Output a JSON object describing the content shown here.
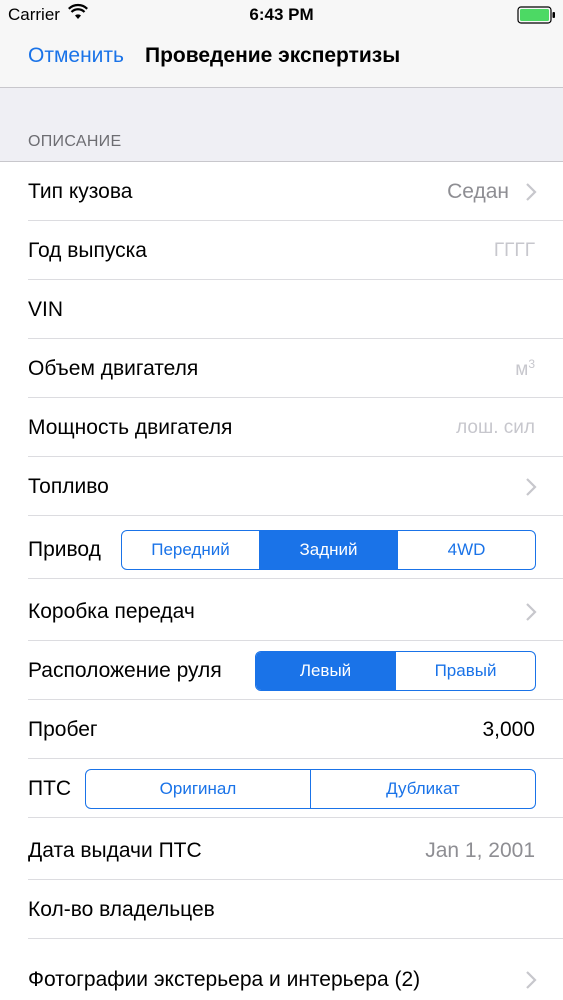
{
  "status_bar": {
    "carrier": "Carrier",
    "time": "6:43 PM"
  },
  "nav": {
    "cancel_label": "Отменить",
    "title": "Проведение экспертизы"
  },
  "section": {
    "header": "ОПИСАНИЕ"
  },
  "rows": {
    "body_type": {
      "label": "Тип кузова",
      "value": "Седан"
    },
    "year": {
      "label": "Год выпуска",
      "placeholder": "ГГГГ"
    },
    "vin": {
      "label": "VIN"
    },
    "engine_volume": {
      "label": "Объем двигателя",
      "placeholder": "м",
      "placeholder_sup": "3"
    },
    "engine_power": {
      "label": "Мощность двигателя",
      "placeholder": "лош. сил"
    },
    "fuel": {
      "label": "Топливо"
    },
    "drive": {
      "label": "Привод",
      "options": [
        "Передний",
        "Задний",
        "4WD"
      ],
      "selected": "Задний"
    },
    "gearbox": {
      "label": "Коробка передач"
    },
    "steering": {
      "label": "Расположение руля",
      "options": [
        "Левый",
        "Правый"
      ],
      "selected": "Левый"
    },
    "mileage": {
      "label": "Пробег",
      "value": "3,000"
    },
    "pts": {
      "label": "ПТС",
      "options": [
        "Оригинал",
        "Дубликат"
      ],
      "selected": null
    },
    "pts_date": {
      "label": "Дата выдачи ПТС",
      "value": "Jan 1, 2001"
    },
    "owners": {
      "label": "Кол-во владельцев"
    },
    "photos": {
      "label": "Фотографии экстерьера и интерьера (2)"
    }
  },
  "colors": {
    "accent": "#1a73e8",
    "secondary_text": "#8e8e93",
    "placeholder": "#c7c7cd",
    "section_bg": "#efeff4",
    "battery": "#4cd964"
  },
  "icons": [
    "wifi-icon",
    "battery-icon",
    "chevron-right-icon"
  ]
}
